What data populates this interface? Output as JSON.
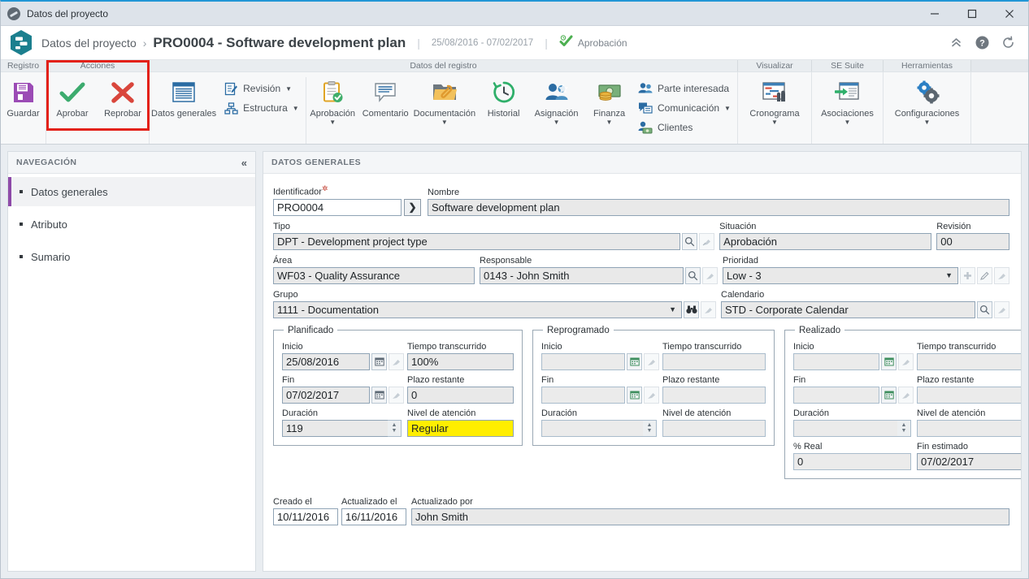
{
  "window": {
    "title": "Datos del proyecto",
    "minimize": "—",
    "maximize": "□",
    "close": "✕"
  },
  "header": {
    "breadcrumb_root": "Datos del proyecto",
    "separator": "›",
    "title": "PRO0004 - Software development plan",
    "pipe": "|",
    "dates": "25/08/2016 - 07/02/2017",
    "pipe2": "|",
    "status": "Aprobación",
    "icon_collapse": "collapse-icon",
    "icon_help": "help-icon",
    "icon_refresh": "refresh-icon"
  },
  "ribbon": {
    "groups": [
      {
        "label": "Registro"
      },
      {
        "label": "Acciones"
      },
      {
        "label": "Datos del registro"
      },
      {
        "label": "Visualizar"
      },
      {
        "label": "SE Suite"
      },
      {
        "label": "Herramientas"
      }
    ],
    "registro": [
      {
        "label": "Guardar",
        "icon": "save-icon"
      }
    ],
    "acciones": [
      {
        "label": "Aprobar",
        "icon": "check-icon"
      },
      {
        "label": "Reprobar",
        "icon": "cross-icon"
      }
    ],
    "datos_registro": {
      "datos_generales": {
        "label": "Datos generales",
        "icon": "document-icon"
      },
      "small_items": [
        {
          "label": "Revisión",
          "icon": "revision-icon",
          "caret": "▼"
        },
        {
          "label": "Estructura",
          "icon": "structure-icon",
          "caret": "▼"
        }
      ],
      "big_items": [
        {
          "label": "Aprobación",
          "icon": "approval-clipboard-icon",
          "caret": "▼"
        },
        {
          "label": "Comentario",
          "icon": "comment-icon",
          "caret": ""
        },
        {
          "label": "Documentación",
          "icon": "folder-attachment-icon",
          "caret": "▼"
        },
        {
          "label": "Historial",
          "icon": "history-clock-icon",
          "caret": ""
        },
        {
          "label": "Asignación",
          "icon": "assignment-people-icon",
          "caret": "▼"
        },
        {
          "label": "Finanza",
          "icon": "finance-money-icon",
          "caret": "▼"
        }
      ],
      "right_small_items": [
        {
          "label": "Parte interesada",
          "icon": "stakeholder-icon",
          "caret": ""
        },
        {
          "label": "Comunicación",
          "icon": "communication-icon",
          "caret": "▼"
        },
        {
          "label": "Clientes",
          "icon": "clients-icon",
          "caret": ""
        }
      ]
    },
    "visualizar": [
      {
        "label": "Cronograma",
        "icon": "gantt-chart-icon",
        "caret": "▼"
      }
    ],
    "se_suite": [
      {
        "label": "Asociaciones",
        "icon": "associations-icon",
        "caret": "▼"
      }
    ],
    "herramientas": [
      {
        "label": "Configuraciones",
        "icon": "gears-icon",
        "caret": "▼"
      }
    ]
  },
  "sidebar": {
    "title": "NAVEGACIÓN",
    "collapse_icon": "«",
    "items": [
      {
        "label": "Datos generales",
        "active": true
      },
      {
        "label": "Atributo",
        "active": false
      },
      {
        "label": "Sumario",
        "active": false
      }
    ]
  },
  "content": {
    "panel_title": "DATOS GENERALES",
    "fields": {
      "identificador": {
        "label": "Identificador",
        "required": true,
        "value": "PRO0004"
      },
      "nombre": {
        "label": "Nombre",
        "value": "Software development plan"
      },
      "tipo": {
        "label": "Tipo",
        "value": "DPT - Development project type"
      },
      "situacion": {
        "label": "Situación",
        "value": "Aprobación"
      },
      "revision": {
        "label": "Revisión",
        "value": "00"
      },
      "area": {
        "label": "Área",
        "value": "WF03 - Quality Assurance"
      },
      "responsable": {
        "label": "Responsable",
        "value": "0143 - John Smith"
      },
      "prioridad": {
        "label": "Prioridad",
        "value": "Low - 3"
      },
      "grupo": {
        "label": "Grupo",
        "value": "1111 - Documentation"
      },
      "calendario": {
        "label": "Calendario",
        "value": "STD - Corporate Calendar"
      },
      "creado_el": {
        "label": "Creado el",
        "value": "10/11/2016"
      },
      "actualizado_el": {
        "label": "Actualizado el",
        "value": "16/11/2016"
      },
      "actualizado_por": {
        "label": "Actualizado por",
        "value": "John Smith"
      }
    },
    "groups": {
      "planificado": {
        "legend": "Planificado",
        "inicio": {
          "label": "Inicio",
          "value": "25/08/2016"
        },
        "tiempo_transcurrido": {
          "label": "Tiempo transcurrido",
          "value": "100%"
        },
        "fin": {
          "label": "Fin",
          "value": "07/02/2017"
        },
        "plazo_restante": {
          "label": "Plazo restante",
          "value": "0"
        },
        "duracion": {
          "label": "Duración",
          "value": "119"
        },
        "nivel_atencion": {
          "label": "Nivel de atención",
          "value": "Regular",
          "highlight": "#ffee00"
        }
      },
      "reprogramado": {
        "legend": "Reprogramado",
        "inicio": {
          "label": "Inicio",
          "value": ""
        },
        "tiempo_transcurrido": {
          "label": "Tiempo transcurrido",
          "value": ""
        },
        "fin": {
          "label": "Fin",
          "value": ""
        },
        "plazo_restante": {
          "label": "Plazo restante",
          "value": ""
        },
        "duracion": {
          "label": "Duración",
          "value": ""
        },
        "nivel_atencion": {
          "label": "Nivel de atención",
          "value": ""
        }
      },
      "realizado": {
        "legend": "Realizado",
        "inicio": {
          "label": "Inicio",
          "value": ""
        },
        "tiempo_transcurrido": {
          "label": "Tiempo transcurrido",
          "value": ""
        },
        "fin": {
          "label": "Fin",
          "value": ""
        },
        "plazo_restante": {
          "label": "Plazo restante",
          "value": ""
        },
        "duracion": {
          "label": "Duración",
          "value": ""
        },
        "nivel_atencion": {
          "label": "Nivel de atención",
          "value": ""
        },
        "pct_real": {
          "label": "% Real",
          "value": "0"
        },
        "fin_estimado": {
          "label": "Fin estimado",
          "value": "07/02/2017"
        }
      }
    }
  },
  "colors": {
    "accent_blue": "#2196d6",
    "sidebar_active_bar": "#8e4aa8",
    "highlight_yellow": "#ffee00",
    "red_annotation": "#e32119",
    "approve_green": "#3cab6e",
    "reject_red": "#d9463c"
  }
}
